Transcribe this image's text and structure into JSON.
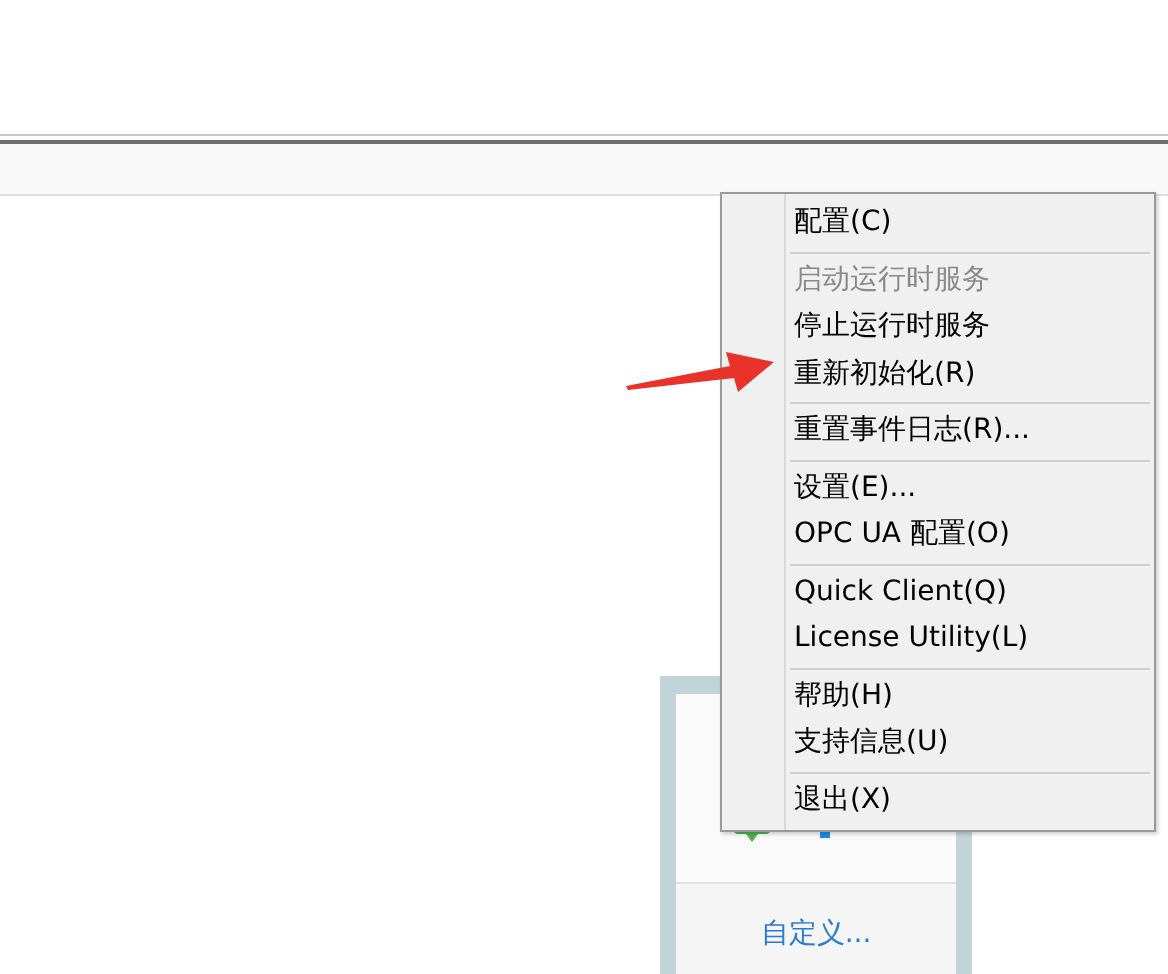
{
  "context_menu": {
    "items": [
      {
        "kind": "item",
        "label": "配置(C)",
        "disabled": false
      },
      {
        "kind": "separator"
      },
      {
        "kind": "item",
        "label": "启动运行时服务",
        "disabled": true
      },
      {
        "kind": "item",
        "label": "停止运行时服务",
        "disabled": false
      },
      {
        "kind": "item",
        "label": "重新初始化(R)",
        "disabled": false
      },
      {
        "kind": "separator"
      },
      {
        "kind": "item",
        "label": "重置事件日志(R)...",
        "disabled": false
      },
      {
        "kind": "separator"
      },
      {
        "kind": "item",
        "label": "设置(E)...",
        "disabled": false
      },
      {
        "kind": "item",
        "label": "OPC UA 配置(O)",
        "disabled": false
      },
      {
        "kind": "separator"
      },
      {
        "kind": "item",
        "label": "Quick Client(Q)",
        "disabled": false
      },
      {
        "kind": "item",
        "label": "License Utility(L)",
        "disabled": false
      },
      {
        "kind": "separator"
      },
      {
        "kind": "item",
        "label": "帮助(H)",
        "disabled": false
      },
      {
        "kind": "item",
        "label": "支持信息(U)",
        "disabled": false
      },
      {
        "kind": "separator"
      },
      {
        "kind": "item",
        "label": "退出(X)",
        "disabled": false
      }
    ]
  },
  "tray_popup": {
    "link": "自定义..."
  }
}
